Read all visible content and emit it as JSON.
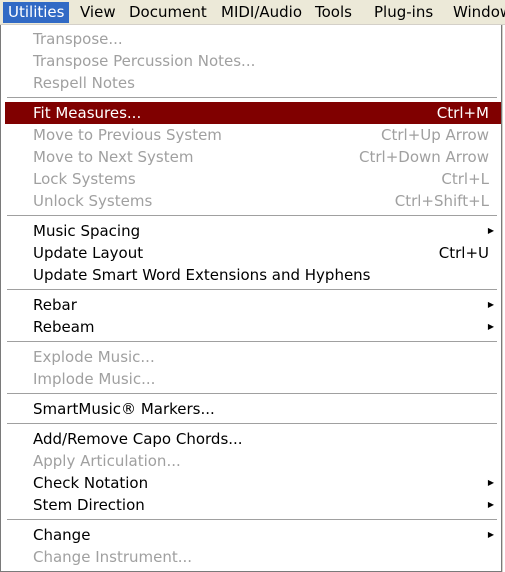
{
  "menubar": {
    "items": [
      {
        "label": "Utilities"
      },
      {
        "label": "View"
      },
      {
        "label": "Document"
      },
      {
        "label": "MIDI/Audio"
      },
      {
        "label": "Tools"
      },
      {
        "label": "Plug-ins"
      },
      {
        "label": "Window"
      }
    ]
  },
  "menu": {
    "items": [
      {
        "label": "Transpose...",
        "shortcut": "",
        "enabled": false
      },
      {
        "label": "Transpose Percussion Notes...",
        "shortcut": "",
        "enabled": false
      },
      {
        "label": "Respell Notes",
        "shortcut": "",
        "enabled": false
      },
      {
        "label": "Fit Measures...",
        "shortcut": "Ctrl+M",
        "enabled": true,
        "highlighted": true
      },
      {
        "label": "Move to Previous System",
        "shortcut": "Ctrl+Up Arrow",
        "enabled": false
      },
      {
        "label": "Move to Next System",
        "shortcut": "Ctrl+Down Arrow",
        "enabled": false
      },
      {
        "label": "Lock Systems",
        "shortcut": "Ctrl+L",
        "enabled": false
      },
      {
        "label": "Unlock Systems",
        "shortcut": "Ctrl+Shift+L",
        "enabled": false
      },
      {
        "label": "Music Spacing",
        "shortcut": "",
        "enabled": true,
        "submenu": true
      },
      {
        "label": "Update Layout",
        "shortcut": "Ctrl+U",
        "enabled": true
      },
      {
        "label": "Update Smart Word Extensions and Hyphens",
        "shortcut": "",
        "enabled": true
      },
      {
        "label": "Rebar",
        "shortcut": "",
        "enabled": true,
        "submenu": true
      },
      {
        "label": "Rebeam",
        "shortcut": "",
        "enabled": true,
        "submenu": true
      },
      {
        "label": "Explode Music...",
        "shortcut": "",
        "enabled": false
      },
      {
        "label": "Implode Music...",
        "shortcut": "",
        "enabled": false
      },
      {
        "label": "SmartMusic® Markers...",
        "shortcut": "",
        "enabled": true
      },
      {
        "label": "Add/Remove Capo Chords...",
        "shortcut": "",
        "enabled": true
      },
      {
        "label": "Apply Articulation...",
        "shortcut": "",
        "enabled": false
      },
      {
        "label": "Check Notation",
        "shortcut": "",
        "enabled": true,
        "submenu": true
      },
      {
        "label": "Stem Direction",
        "shortcut": "",
        "enabled": true,
        "submenu": true
      },
      {
        "label": "Change",
        "shortcut": "",
        "enabled": true,
        "submenu": true
      },
      {
        "label": "Change Instrument...",
        "shortcut": "",
        "enabled": false
      }
    ],
    "submenu_arrow": "▶"
  },
  "colors": {
    "menubar_active": "#316ac5",
    "highlight": "#800000",
    "disabled_text": "#a0a0a0"
  }
}
